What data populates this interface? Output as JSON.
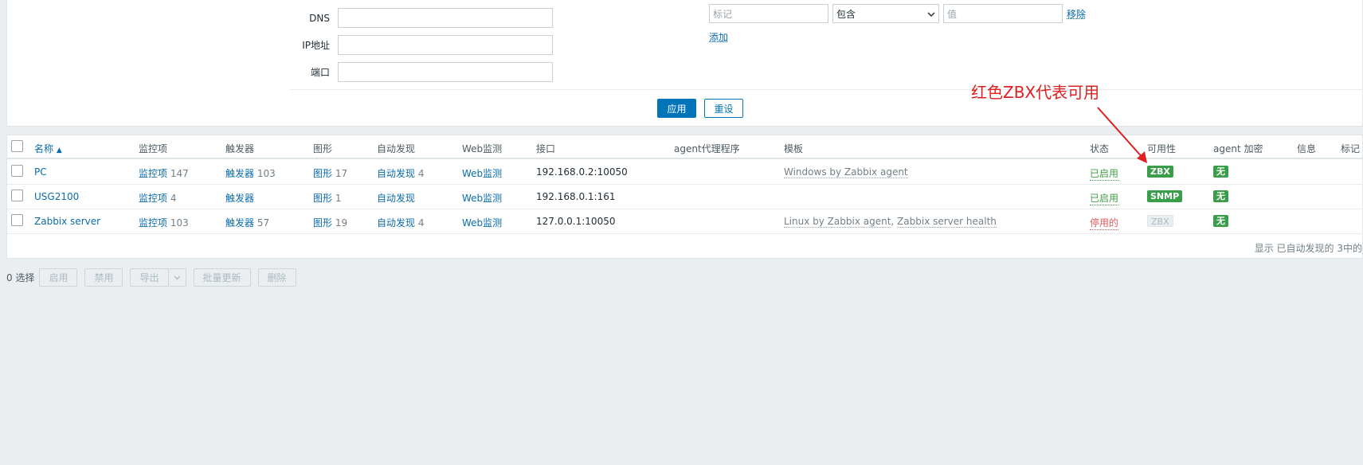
{
  "filter": {
    "dns_label": "DNS",
    "ip_label": "IP地址",
    "port_label": "端口",
    "tag_placeholder": "标记",
    "tag_operator": "包含",
    "value_placeholder": "值",
    "remove_link": "移除",
    "add_link": "添加",
    "apply_button": "应用",
    "reset_button": "重设"
  },
  "table": {
    "headers": {
      "name": "名称",
      "items": "监控项",
      "triggers": "触发器",
      "graphs": "图形",
      "discovery": "自动发现",
      "web": "Web监测",
      "interface": "接口",
      "proxy": "agent代理程序",
      "templates": "模板",
      "status": "状态",
      "availability": "可用性",
      "encryption": "agent 加密",
      "info": "信息",
      "tags": "标记"
    },
    "rows": [
      {
        "name": "PC",
        "items_label": "监控项",
        "items_count": "147",
        "triggers_label": "触发器",
        "triggers_count": "103",
        "graphs_label": "图形",
        "graphs_count": "17",
        "discovery_label": "自动发现",
        "discovery_count": "4",
        "web": "Web监测",
        "interface": "192.168.0.2:10050",
        "templates": "Windows by Zabbix agent",
        "status": "已启用",
        "availability": "ZBX",
        "encryption": "无"
      },
      {
        "name": "USG2100",
        "items_label": "监控项",
        "items_count": "4",
        "triggers_label": "触发器",
        "triggers_count": "",
        "graphs_label": "图形",
        "graphs_count": "1",
        "discovery_label": "自动发现",
        "discovery_count": "",
        "web": "Web监测",
        "interface": "192.168.0.1:161",
        "templates": "",
        "status": "已启用",
        "availability": "SNMP",
        "encryption": "无"
      },
      {
        "name": "Zabbix server",
        "items_label": "监控项",
        "items_count": "103",
        "triggers_label": "触发器",
        "triggers_count": "57",
        "graphs_label": "图形",
        "graphs_count": "19",
        "discovery_label": "自动发现",
        "discovery_count": "4",
        "web": "Web监测",
        "interface": "127.0.0.1:10050",
        "templates_a": "Linux by Zabbix agent",
        "templates_sep": ", ",
        "templates_b": "Zabbix server health",
        "status": "停用的",
        "availability": "ZBX",
        "encryption": "无"
      }
    ],
    "footer": "显示 已自动发现的 3中的"
  },
  "actions": {
    "selected": "0 选择",
    "enable": "启用",
    "disable": "禁用",
    "export": "导出",
    "mass_update": "批量更新",
    "delete": "删除"
  },
  "annotation": {
    "text": "红色ZBX代表可用",
    "color": "#e02020"
  },
  "colors": {
    "primary": "#0275b8",
    "link": "#0a6bad",
    "enabled": "#429e47",
    "disabled": "#e45959",
    "badge_green": "#3a9d4a"
  }
}
